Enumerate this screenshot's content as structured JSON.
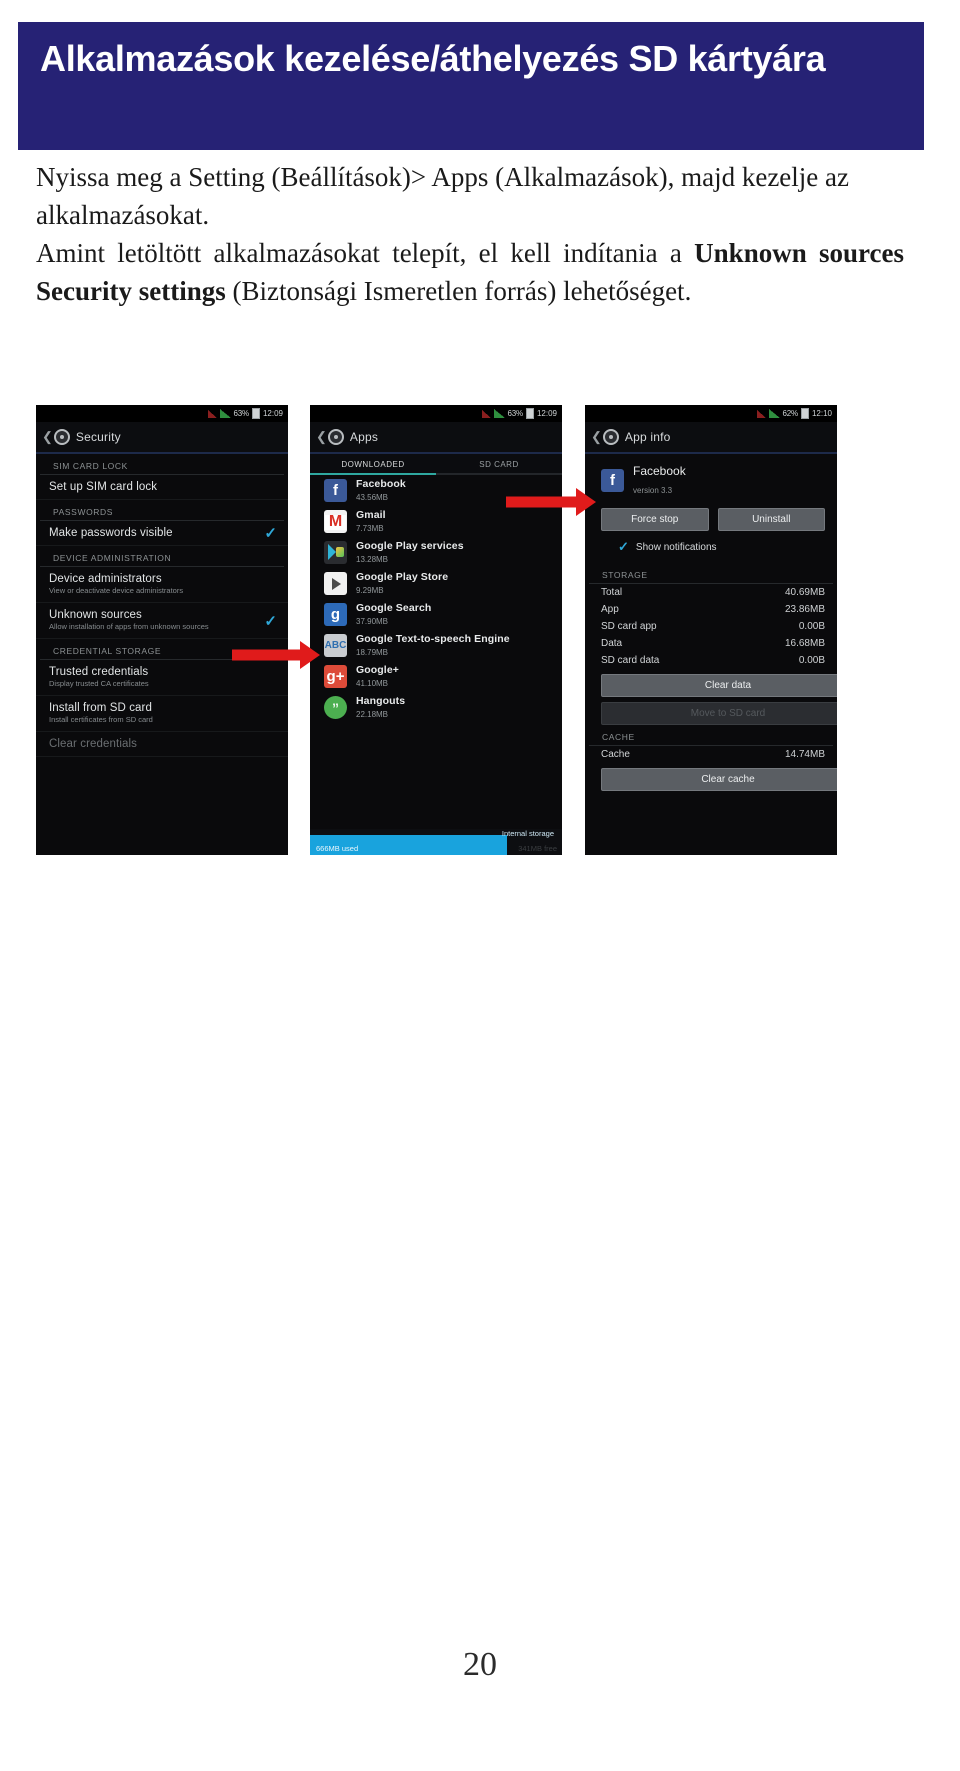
{
  "document": {
    "title": "Alkalmazások kezelése/áthelyezés SD kártyára",
    "page_number": "20",
    "banner_color": "#262275"
  },
  "body": {
    "paragraph1": "Nyissa meg a Setting (Beállítások)> Apps (Alkalmazások), majd kezelje az alkalmazásokat.",
    "paragraph2_part1": "Amint letöltött alkalmazásokat telepít, el kell indítania a ",
    "paragraph2_bold1": "Unknown sources",
    "paragraph2_gap": "  ",
    "paragraph2_bold2": "Security settings",
    "paragraph2_part2": " (Biztonsági Ismeretlen forrás) lehetőséget."
  },
  "screenshot1": {
    "name": "security-settings-screen",
    "statusbar": {
      "battery": "63%",
      "clock": "12:09"
    },
    "actionbar_title": "Security",
    "sections": [
      {
        "header": "SIM CARD LOCK",
        "rows": [
          {
            "title": "Set up SIM card lock",
            "sub": "",
            "checked": false
          }
        ]
      },
      {
        "header": "PASSWORDS",
        "rows": [
          {
            "title": "Make passwords visible",
            "sub": "",
            "checked": true
          }
        ]
      },
      {
        "header": "DEVICE ADMINISTRATION",
        "rows": [
          {
            "title": "Device administrators",
            "sub": "View or deactivate device administrators",
            "checked": false
          },
          {
            "title": "Unknown sources",
            "sub": "Allow installation of apps from unknown sources",
            "checked": true
          }
        ]
      },
      {
        "header": "CREDENTIAL STORAGE",
        "rows": [
          {
            "title": "Trusted credentials",
            "sub": "Display trusted CA certificates",
            "checked": false
          },
          {
            "title": "Install from SD card",
            "sub": "Install certificates from SD card",
            "checked": false
          },
          {
            "title": "Clear credentials",
            "sub": "",
            "checked": false,
            "dim": true
          }
        ]
      }
    ]
  },
  "screenshot2": {
    "name": "apps-list-screen",
    "statusbar": {
      "battery": "63%",
      "clock": "12:09"
    },
    "actionbar_title": "Apps",
    "tabs": [
      {
        "label": "DOWNLOADED",
        "active": true
      },
      {
        "label": "SD CARD",
        "active": false
      }
    ],
    "apps": [
      {
        "name": "Facebook",
        "size": "43.56MB",
        "icon": "facebook-icon"
      },
      {
        "name": "Gmail",
        "size": "7.73MB",
        "icon": "gmail-icon"
      },
      {
        "name": "Google Play services",
        "size": "13.28MB",
        "icon": "google-play-services-icon"
      },
      {
        "name": "Google Play Store",
        "size": "9.29MB",
        "icon": "google-play-store-icon"
      },
      {
        "name": "Google Search",
        "size": "37.90MB",
        "icon": "google-search-icon"
      },
      {
        "name": "Google Text-to-speech Engine",
        "size": "18.79MB",
        "icon": "text-to-speech-icon"
      },
      {
        "name": "Google+",
        "size": "41.10MB",
        "icon": "google-plus-icon"
      },
      {
        "name": "Hangouts",
        "size": "22.18MB",
        "icon": "hangouts-icon"
      }
    ],
    "storage": {
      "label": "Internal storage",
      "used": "666MB used",
      "free": "341MB free"
    }
  },
  "screenshot3": {
    "name": "app-info-screen",
    "statusbar": {
      "battery": "62%",
      "clock": "12:10"
    },
    "actionbar_title": "App info",
    "app": {
      "name": "Facebook",
      "version": "version 3.3",
      "icon": "facebook-icon"
    },
    "buttons": {
      "force_stop": "Force stop",
      "uninstall": "Uninstall",
      "clear_data": "Clear data",
      "move_to_sd": "Move to SD card",
      "clear_cache": "Clear cache"
    },
    "show_notifications": "Show notifications",
    "storage_header": "STORAGE",
    "storage_rows": [
      {
        "label": "Total",
        "value": "40.69MB"
      },
      {
        "label": "App",
        "value": "23.86MB"
      },
      {
        "label": "SD card app",
        "value": "0.00B"
      },
      {
        "label": "Data",
        "value": "16.68MB"
      },
      {
        "label": "SD card data",
        "value": "0.00B"
      }
    ],
    "cache_header": "CACHE",
    "cache_rows": [
      {
        "label": "Cache",
        "value": "14.74MB"
      }
    ]
  },
  "annotations": {
    "arrow1": "red-arrow-pointing-to-unknown-sources",
    "arrow2": "red-arrow-pointing-to-facebook-app-info"
  }
}
